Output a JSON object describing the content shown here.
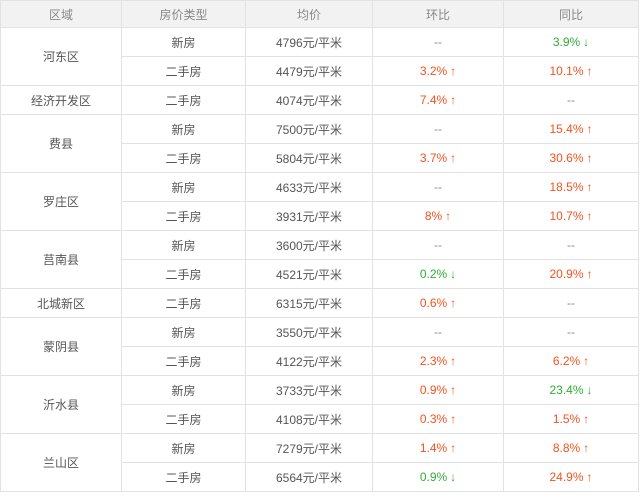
{
  "colors": {
    "up": "#f2531f",
    "down": "#2fad35",
    "flat": "#888888",
    "header_bg": "#f2f2f2",
    "border": "#e2e2e2"
  },
  "headers": [
    "区域",
    "房价类型",
    "均价",
    "环比",
    "同比"
  ],
  "groups": [
    {
      "region": "河东区",
      "rows": [
        {
          "type": "新房",
          "price": "4796元/平米",
          "mom": {
            "text": "--",
            "dir": "flat"
          },
          "yoy": {
            "text": "3.9%",
            "dir": "down"
          }
        },
        {
          "type": "二手房",
          "price": "4479元/平米",
          "mom": {
            "text": "3.2%",
            "dir": "up"
          },
          "yoy": {
            "text": "10.1%",
            "dir": "up"
          }
        }
      ]
    },
    {
      "region": "经济开发区",
      "rows": [
        {
          "type": "二手房",
          "price": "4074元/平米",
          "mom": {
            "text": "7.4%",
            "dir": "up"
          },
          "yoy": {
            "text": "--",
            "dir": "flat"
          }
        }
      ]
    },
    {
      "region": "费县",
      "rows": [
        {
          "type": "新房",
          "price": "7500元/平米",
          "mom": {
            "text": "--",
            "dir": "flat"
          },
          "yoy": {
            "text": "15.4%",
            "dir": "up"
          }
        },
        {
          "type": "二手房",
          "price": "5804元/平米",
          "mom": {
            "text": "3.7%",
            "dir": "up"
          },
          "yoy": {
            "text": "30.6%",
            "dir": "up"
          }
        }
      ]
    },
    {
      "region": "罗庄区",
      "rows": [
        {
          "type": "新房",
          "price": "4633元/平米",
          "mom": {
            "text": "--",
            "dir": "flat"
          },
          "yoy": {
            "text": "18.5%",
            "dir": "up"
          }
        },
        {
          "type": "二手房",
          "price": "3931元/平米",
          "mom": {
            "text": "8%",
            "dir": "up"
          },
          "yoy": {
            "text": "10.7%",
            "dir": "up"
          }
        }
      ]
    },
    {
      "region": "莒南县",
      "rows": [
        {
          "type": "新房",
          "price": "3600元/平米",
          "mom": {
            "text": "--",
            "dir": "flat"
          },
          "yoy": {
            "text": "--",
            "dir": "flat"
          }
        },
        {
          "type": "二手房",
          "price": "4521元/平米",
          "mom": {
            "text": "0.2%",
            "dir": "down"
          },
          "yoy": {
            "text": "20.9%",
            "dir": "up"
          }
        }
      ]
    },
    {
      "region": "北城新区",
      "rows": [
        {
          "type": "二手房",
          "price": "6315元/平米",
          "mom": {
            "text": "0.6%",
            "dir": "up"
          },
          "yoy": {
            "text": "--",
            "dir": "flat"
          }
        }
      ]
    },
    {
      "region": "蒙阴县",
      "rows": [
        {
          "type": "新房",
          "price": "3550元/平米",
          "mom": {
            "text": "--",
            "dir": "flat"
          },
          "yoy": {
            "text": "--",
            "dir": "flat"
          }
        },
        {
          "type": "二手房",
          "price": "4122元/平米",
          "mom": {
            "text": "2.3%",
            "dir": "up"
          },
          "yoy": {
            "text": "6.2%",
            "dir": "up"
          }
        }
      ]
    },
    {
      "region": "沂水县",
      "rows": [
        {
          "type": "新房",
          "price": "3733元/平米",
          "mom": {
            "text": "0.9%",
            "dir": "up"
          },
          "yoy": {
            "text": "23.4%",
            "dir": "down"
          }
        },
        {
          "type": "二手房",
          "price": "4108元/平米",
          "mom": {
            "text": "0.3%",
            "dir": "up"
          },
          "yoy": {
            "text": "1.5%",
            "dir": "up"
          }
        }
      ]
    },
    {
      "region": "兰山区",
      "rows": [
        {
          "type": "新房",
          "price": "7279元/平米",
          "mom": {
            "text": "1.4%",
            "dir": "up"
          },
          "yoy": {
            "text": "8.8%",
            "dir": "up"
          }
        },
        {
          "type": "二手房",
          "price": "6564元/平米",
          "mom": {
            "text": "0.9%",
            "dir": "down"
          },
          "yoy": {
            "text": "24.9%",
            "dir": "up"
          }
        }
      ]
    }
  ]
}
